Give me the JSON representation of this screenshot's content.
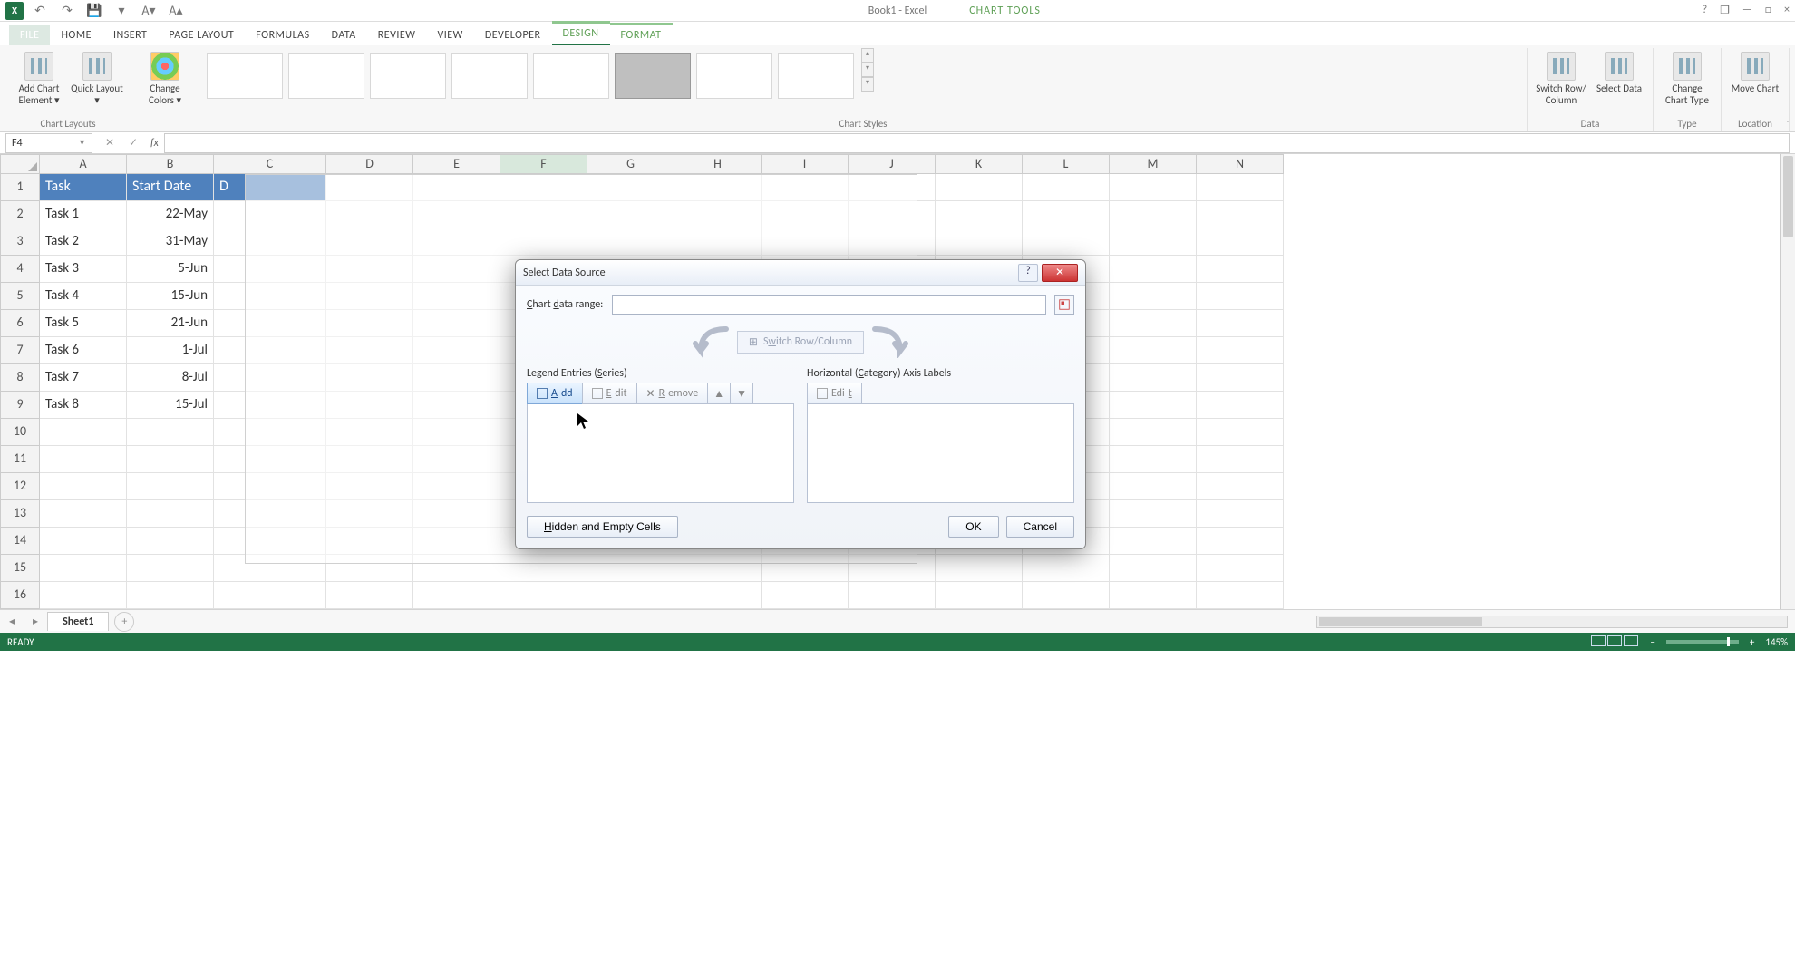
{
  "titlebar": {
    "doc_title": "Book1 - Excel",
    "chart_tools": "CHART TOOLS",
    "help": "?",
    "restore": "❐",
    "minimize": "—",
    "maximize": "□",
    "close": "×",
    "app_initial": "X"
  },
  "qat": {
    "save": "💾",
    "undo": "↶",
    "redo": "↷"
  },
  "ribbon_tabs": {
    "file": "FILE",
    "home": "HOME",
    "insert": "INSERT",
    "page_layout": "PAGE LAYOUT",
    "formulas": "FORMULAS",
    "data": "DATA",
    "review": "REVIEW",
    "view": "VIEW",
    "developer": "DEVELOPER",
    "design": "DESIGN",
    "format": "FORMAT"
  },
  "ribbon": {
    "add_chart_element": "Add Chart Element ▾",
    "quick_layout": "Quick Layout ▾",
    "change_colors": "Change Colors ▾",
    "switch_row_col": "Switch Row/ Column",
    "select_data": "Select Data",
    "change_chart_type": "Change Chart Type",
    "move_chart": "Move Chart",
    "group_chart_layouts": "Chart Layouts",
    "group_chart_styles": "Chart Styles",
    "group_data": "Data",
    "group_type": "Type",
    "group_location": "Location"
  },
  "formula_bar": {
    "name_box": "F4",
    "cancel": "✕",
    "enter": "✓",
    "fx": "fx"
  },
  "columns": [
    "A",
    "B",
    "C",
    "D",
    "E",
    "F",
    "G",
    "H",
    "I",
    "J",
    "K",
    "L",
    "M",
    "N"
  ],
  "active_col": "F",
  "rows": [
    "1",
    "2",
    "3",
    "4",
    "5",
    "6",
    "7",
    "8",
    "9",
    "10",
    "11",
    "12",
    "13",
    "14",
    "15",
    "16"
  ],
  "header_row": {
    "a": "Task",
    "b": "Start Date",
    "c": "D"
  },
  "data_rows": [
    {
      "a": "Task 1",
      "b": "22-May"
    },
    {
      "a": "Task 2",
      "b": "31-May"
    },
    {
      "a": "Task 3",
      "b": "5-Jun"
    },
    {
      "a": "Task 4",
      "b": "15-Jun"
    },
    {
      "a": "Task 5",
      "b": "21-Jun"
    },
    {
      "a": "Task 6",
      "b": "1-Jul"
    },
    {
      "a": "Task 7",
      "b": "8-Jul"
    },
    {
      "a": "Task 8",
      "b": "15-Jul"
    }
  ],
  "sheet_tabs": {
    "sheet1": "Sheet1",
    "add": "+"
  },
  "statusbar": {
    "ready": "READY",
    "zoom": "145%"
  },
  "dialog": {
    "title": "Select Data Source",
    "chart_data_range": "Chart data range:",
    "switch_row_col": "Switch Row/Column",
    "legend_entries": "Legend Entries (Series)",
    "horiz_axis": "Horizontal (Category) Axis Labels",
    "add": "Add",
    "edit": "Edit",
    "remove": "Remove",
    "up": "▲",
    "down": "▼",
    "edit2": "Edit",
    "hidden_empty": "Hidden and Empty Cells",
    "ok": "OK",
    "cancel": "Cancel"
  }
}
